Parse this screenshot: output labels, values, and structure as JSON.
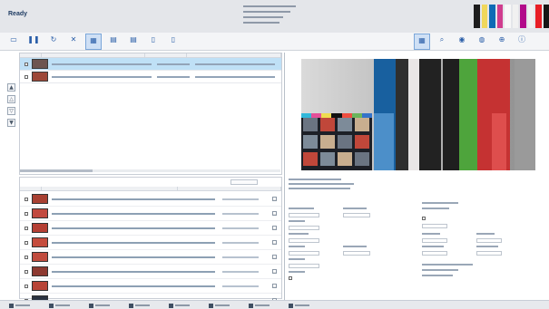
{
  "header": {
    "app_title": "Ready",
    "swatch_colors": [
      "#1d1d1d",
      "#f0d75b",
      "#0d6ab5",
      "#d03d8e",
      "#f8f8f8",
      "#f1f1f1",
      "#b20a8a",
      "#f1f1f1",
      "#e81e25",
      "#161616"
    ]
  },
  "toolbar": {
    "left_buttons": [
      {
        "name": "toolbar-button-1",
        "icon": "save-icon",
        "glyph": "▭",
        "label": ""
      },
      {
        "name": "toolbar-button-2",
        "icon": "pause-icon",
        "glyph": "❚❚",
        "label": ""
      },
      {
        "name": "toolbar-button-3",
        "icon": "refresh-icon",
        "glyph": "↻",
        "label": ""
      },
      {
        "name": "toolbar-button-4",
        "icon": "close-icon",
        "glyph": "✕",
        "label": ""
      },
      {
        "name": "toolbar-button-5",
        "icon": "grid-icon",
        "glyph": "▦",
        "label": "",
        "active": true
      },
      {
        "name": "toolbar-button-6",
        "icon": "layers-icon",
        "glyph": "▤",
        "label": ""
      },
      {
        "name": "toolbar-button-7",
        "icon": "layers-icon",
        "glyph": "▤",
        "label": ""
      },
      {
        "name": "toolbar-button-8",
        "icon": "document-icon",
        "glyph": "▯",
        "label": ""
      },
      {
        "name": "toolbar-button-9",
        "icon": "document-icon",
        "glyph": "▯",
        "label": ""
      }
    ],
    "right_buttons": [
      {
        "name": "toolbar-button-right-1",
        "icon": "grid-icon",
        "glyph": "▦",
        "label": "",
        "active": true
      },
      {
        "name": "toolbar-button-right-2",
        "icon": "zoom-icon",
        "glyph": "⌕",
        "label": ""
      },
      {
        "name": "toolbar-button-right-3",
        "icon": "eye-icon",
        "glyph": "◉",
        "label": ""
      },
      {
        "name": "toolbar-button-right-4",
        "icon": "person-icon",
        "glyph": "◍",
        "label": ""
      },
      {
        "name": "toolbar-button-right-5",
        "icon": "target-icon",
        "glyph": "⊕",
        "label": ""
      },
      {
        "name": "toolbar-button-right-6",
        "icon": "info-icon",
        "glyph": "ⓘ",
        "label": ""
      }
    ]
  },
  "side_rail": {
    "buttons": [
      {
        "name": "rail-button-1",
        "icon": "up-arrow-icon",
        "glyph": "▲"
      },
      {
        "name": "rail-button-2",
        "icon": "up-icon",
        "glyph": "△"
      },
      {
        "name": "rail-button-3",
        "icon": "down-icon",
        "glyph": "▽"
      },
      {
        "name": "rail-button-4",
        "icon": "down-arrow-icon",
        "glyph": "▼"
      }
    ]
  },
  "jobs": {
    "rows": [
      {
        "thumb": "#6e5550",
        "selected": true
      },
      {
        "thumb": "#9d4737",
        "selected": false
      }
    ]
  },
  "outputs": {
    "title": "",
    "filter": "",
    "rows": [
      {
        "thumb": "#a84032"
      },
      {
        "thumb": "#c24a3f"
      },
      {
        "thumb": "#b53f34"
      },
      {
        "thumb": "#c54c3d"
      },
      {
        "thumb": "#c14c3e"
      },
      {
        "thumb": "#8d3930"
      },
      {
        "thumb": "#b84436"
      },
      {
        "thumb": "#2a3240"
      }
    ]
  },
  "preview": {
    "bars": [
      {
        "color": "#18609f",
        "type": "main"
      },
      {
        "color": "#4c8fc9",
        "type": "lower"
      },
      {
        "color": "#2f2f2f",
        "type": "main"
      },
      {
        "color": "#e9e6e6",
        "type": "main"
      },
      {
        "color": "#222222",
        "type": "main"
      },
      {
        "color": "#1f1f1f",
        "type": "main"
      },
      {
        "color": "#4ea43c",
        "type": "main"
      },
      {
        "color": "#c53232",
        "type": "main"
      },
      {
        "color": "#de4e4d",
        "type": "lower"
      },
      {
        "color": "#9a9a9a",
        "type": "main"
      }
    ],
    "cmyk": [
      "#31b8da",
      "#e44f98",
      "#efdc4f",
      "#111111",
      "#ef4e40",
      "#6ab55b",
      "#3473c9"
    ],
    "photos": [
      "#6a7482",
      "#c0473a",
      "#7d8b99",
      "#c8ae8f"
    ],
    "detail_title": ""
  },
  "taskbar": {
    "items": [
      {
        "name": "taskbar-item-1",
        "icon": "app-icon"
      },
      {
        "name": "taskbar-item-2",
        "icon": "pen-icon"
      },
      {
        "name": "taskbar-item-3",
        "icon": "print-icon"
      },
      {
        "name": "taskbar-item-4",
        "icon": "document-icon"
      },
      {
        "name": "taskbar-item-5",
        "icon": "folder-icon"
      },
      {
        "name": "taskbar-item-6",
        "icon": "monitor-icon"
      },
      {
        "name": "taskbar-item-7",
        "icon": "window-icon"
      },
      {
        "name": "taskbar-item-8",
        "icon": "search-icon"
      }
    ]
  }
}
